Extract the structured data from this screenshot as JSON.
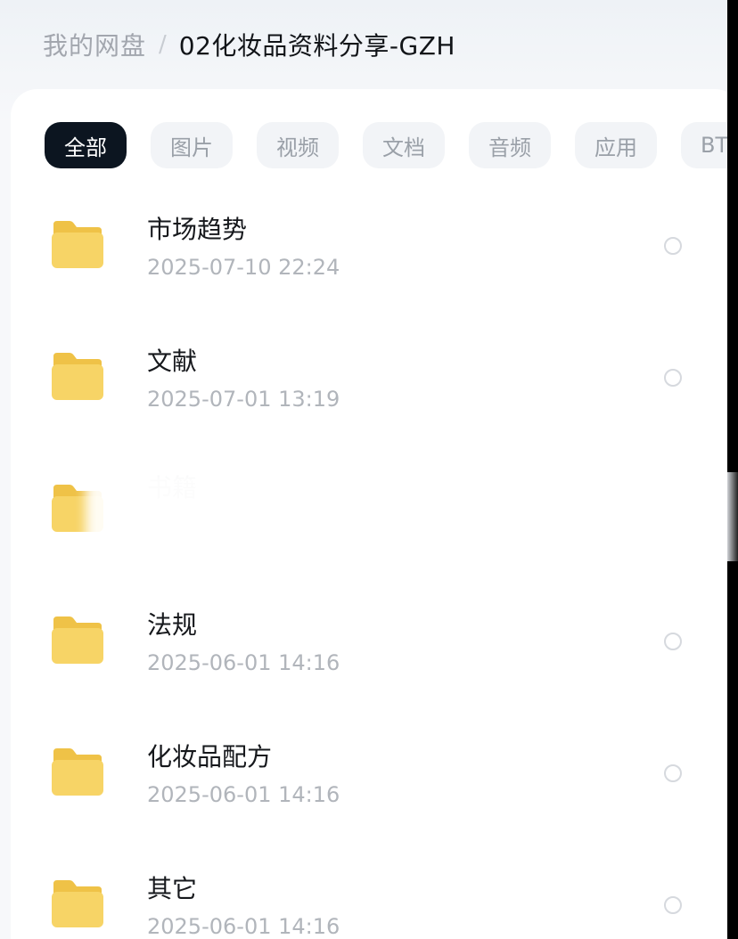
{
  "breadcrumb": {
    "root": "我的网盘",
    "separator": "/",
    "current": "02化妆品资料分享-GZH"
  },
  "tabs": [
    {
      "label": "全部",
      "active": true
    },
    {
      "label": "图片",
      "active": false
    },
    {
      "label": "视频",
      "active": false
    },
    {
      "label": "文档",
      "active": false
    },
    {
      "label": "音频",
      "active": false
    },
    {
      "label": "应用",
      "active": false
    },
    {
      "label": "BT",
      "active": false
    }
  ],
  "files": [
    {
      "name": "市场趋势",
      "date": "2025-07-10  22:24",
      "icon": "folder-icon"
    },
    {
      "name": "文献",
      "date": "2025-07-01  13:19",
      "icon": "folder-icon"
    },
    {
      "name": "书籍",
      "date": "",
      "icon": "folder-icon"
    },
    {
      "name": "法规",
      "date": "2025-06-01  14:16",
      "icon": "folder-icon"
    },
    {
      "name": "化妆品配方",
      "date": "2025-06-01  14:16",
      "icon": "folder-icon"
    },
    {
      "name": "其它",
      "date": "2025-06-01  14:16",
      "icon": "folder-icon"
    }
  ],
  "colors": {
    "active_tab_bg": "#0c1520",
    "tab_bg": "#f2f4f7",
    "folder_yellow": "#f7d466",
    "folder_yellow_dark": "#efc247"
  }
}
